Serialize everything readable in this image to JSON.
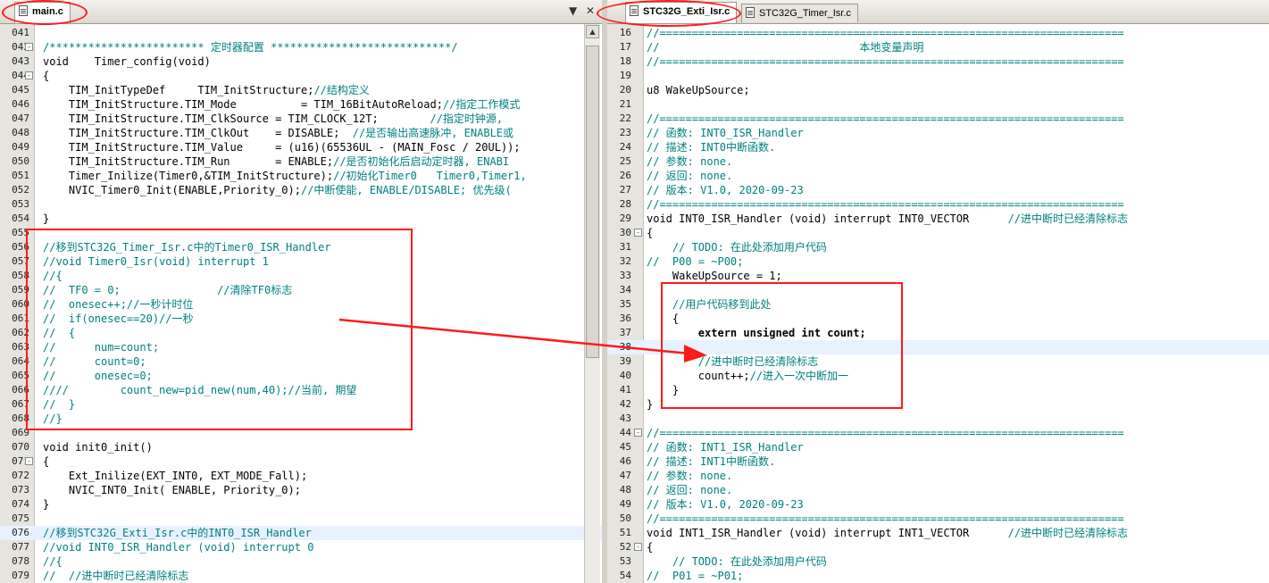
{
  "colors": {
    "comment": "#008080",
    "annotation": "#ff1a1a",
    "current_line": "#e8f2fe",
    "gutter": "#e6e4de"
  },
  "left_editor": {
    "tabs": [
      {
        "label": "main.c",
        "icon": "file-icon",
        "active": true
      }
    ],
    "tab_controls": {
      "dropdown": "▼",
      "close": "✕"
    },
    "lines": [
      {
        "n": "041",
        "t": "",
        "fold": ""
      },
      {
        "n": "042",
        "t": "/************************ 定时器配置 ****************************/",
        "fold": "-",
        "style": "cm"
      },
      {
        "n": "043",
        "t": "void    Timer_config(void)",
        "fold": ""
      },
      {
        "n": "044",
        "t": "{",
        "fold": "-"
      },
      {
        "n": "045",
        "t": "    TIM_InitTypeDef     TIM_InitStructure;//结构定义",
        "fold": ""
      },
      {
        "n": "046",
        "t": "    TIM_InitStructure.TIM_Mode          = TIM_16BitAutoReload;//指定工作模式",
        "fold": ""
      },
      {
        "n": "047",
        "t": "    TIM_InitStructure.TIM_ClkSource = TIM_CLOCK_12T;        //指定时钟源,",
        "fold": ""
      },
      {
        "n": "048",
        "t": "    TIM_InitStructure.TIM_ClkOut    = DISABLE;  //是否输出高速脉冲, ENABLE或",
        "fold": ""
      },
      {
        "n": "049",
        "t": "    TIM_InitStructure.TIM_Value     = (u16)(65536UL - (MAIN_Fosc / 20UL));",
        "fold": ""
      },
      {
        "n": "050",
        "t": "    TIM_InitStructure.TIM_Run       = ENABLE;//是否初始化后启动定时器, ENABI",
        "fold": ""
      },
      {
        "n": "051",
        "t": "    Timer_Inilize(Timer0,&TIM_InitStructure);//初始化Timer0   Timer0,Timer1,",
        "fold": ""
      },
      {
        "n": "052",
        "t": "    NVIC_Timer0_Init(ENABLE,Priority_0);//中断使能, ENABLE/DISABLE; 优先级(",
        "fold": ""
      },
      {
        "n": "053",
        "t": "",
        "fold": ""
      },
      {
        "n": "054",
        "t": "}",
        "fold": ""
      },
      {
        "n": "055",
        "t": "",
        "fold": ""
      },
      {
        "n": "056",
        "t": "//移到STC32G_Timer_Isr.c中的Timer0_ISR_Handler",
        "fold": "",
        "style": "cm"
      },
      {
        "n": "057",
        "t": "//void Timer0_Isr(void) interrupt 1",
        "fold": "",
        "style": "cm"
      },
      {
        "n": "058",
        "t": "//{",
        "fold": "",
        "style": "cm"
      },
      {
        "n": "059",
        "t": "//  TF0 = 0;               //清除TF0标志",
        "fold": "",
        "style": "cm"
      },
      {
        "n": "060",
        "t": "//  onesec++;//一秒计时位",
        "fold": "",
        "style": "cm"
      },
      {
        "n": "061",
        "t": "//  if(onesec==20)//一秒",
        "fold": "",
        "style": "cm"
      },
      {
        "n": "062",
        "t": "//  {",
        "fold": "",
        "style": "cm"
      },
      {
        "n": "063",
        "t": "//      num=count;",
        "fold": "",
        "style": "cm"
      },
      {
        "n": "064",
        "t": "//      count=0;",
        "fold": "",
        "style": "cm"
      },
      {
        "n": "065",
        "t": "//      onesec=0;",
        "fold": "",
        "style": "cm"
      },
      {
        "n": "066",
        "t": "////        count_new=pid_new(num,40);//当前, 期望",
        "fold": "",
        "style": "cm"
      },
      {
        "n": "067",
        "t": "//  }",
        "fold": "",
        "style": "cm"
      },
      {
        "n": "068",
        "t": "//}",
        "fold": "",
        "style": "cm"
      },
      {
        "n": "069",
        "t": "",
        "fold": ""
      },
      {
        "n": "070",
        "t": "void init0_init()",
        "fold": ""
      },
      {
        "n": "071",
        "t": "{",
        "fold": "-"
      },
      {
        "n": "072",
        "t": "    Ext_Inilize(EXT_INT0, EXT_MODE_Fall);",
        "fold": ""
      },
      {
        "n": "073",
        "t": "    NVIC_INT0_Init( ENABLE, Priority_0);",
        "fold": ""
      },
      {
        "n": "074",
        "t": "}",
        "fold": ""
      },
      {
        "n": "075",
        "t": "",
        "fold": ""
      },
      {
        "n": "076",
        "t": "//移到STC32G_Exti_Isr.c中的INT0_ISR_Handler",
        "fold": "",
        "style": "cm",
        "current": true
      },
      {
        "n": "077",
        "t": "//void INT0_ISR_Handler (void) interrupt 0",
        "fold": "",
        "style": "cm"
      },
      {
        "n": "078",
        "t": "//{",
        "fold": "",
        "style": "cm"
      },
      {
        "n": "079",
        "t": "//  //进中断时已经清除标志",
        "fold": "",
        "style": "cm"
      }
    ]
  },
  "right_editor": {
    "tabs": [
      {
        "label": "STC32G_Exti_Isr.c",
        "icon": "file-icon",
        "active": true
      },
      {
        "label": "STC32G_Timer_Isr.c",
        "icon": "file-icon",
        "active": false
      }
    ],
    "lines": [
      {
        "n": "16",
        "t": "//========================================================================",
        "fold": "",
        "style": "cm"
      },
      {
        "n": "17",
        "t": "//                               本地变量声明",
        "fold": "",
        "style": "cm"
      },
      {
        "n": "18",
        "t": "//========================================================================",
        "fold": "",
        "style": "cm"
      },
      {
        "n": "19",
        "t": "",
        "fold": ""
      },
      {
        "n": "20",
        "t": "u8 WakeUpSource;",
        "fold": ""
      },
      {
        "n": "21",
        "t": "",
        "fold": ""
      },
      {
        "n": "22",
        "t": "//========================================================================",
        "fold": "",
        "style": "cm"
      },
      {
        "n": "23",
        "t": "// 函数: INT0_ISR_Handler",
        "fold": "",
        "style": "cm"
      },
      {
        "n": "24",
        "t": "// 描述: INT0中断函数.",
        "fold": "",
        "style": "cm"
      },
      {
        "n": "25",
        "t": "// 参数: none.",
        "fold": "",
        "style": "cm"
      },
      {
        "n": "26",
        "t": "// 返回: none.",
        "fold": "",
        "style": "cm"
      },
      {
        "n": "27",
        "t": "// 版本: V1.0, 2020-09-23",
        "fold": "",
        "style": "cm"
      },
      {
        "n": "28",
        "t": "//========================================================================",
        "fold": "",
        "style": "cm"
      },
      {
        "n": "29",
        "t": "void INT0_ISR_Handler (void) interrupt INT0_VECTOR      //进中断时已经清除标志",
        "fold": "",
        "mixed": true
      },
      {
        "n": "30",
        "t": "{",
        "fold": "-"
      },
      {
        "n": "31",
        "t": "    // TODO: 在此处添加用户代码",
        "fold": "",
        "style": "cm"
      },
      {
        "n": "32",
        "t": "//  P00 = ~P00;",
        "fold": "",
        "style": "cm"
      },
      {
        "n": "33",
        "t": "    WakeUpSource = 1;",
        "fold": ""
      },
      {
        "n": "34",
        "t": "",
        "fold": ""
      },
      {
        "n": "35",
        "t": "    //用户代码移到此处",
        "fold": "",
        "style": "cm"
      },
      {
        "n": "36",
        "t": "    {",
        "fold": ""
      },
      {
        "n": "37",
        "t": "        extern unsigned int count;",
        "fold": "",
        "style": "bold"
      },
      {
        "n": "38",
        "t": "        ",
        "fold": "",
        "current": true
      },
      {
        "n": "39",
        "t": "        //进中断时已经清除标志",
        "fold": "",
        "style": "cm"
      },
      {
        "n": "40",
        "t": "        count++;//进入一次中断加一",
        "fold": "",
        "mixed2": true
      },
      {
        "n": "41",
        "t": "    }",
        "fold": ""
      },
      {
        "n": "42",
        "t": "}",
        "fold": ""
      },
      {
        "n": "43",
        "t": "",
        "fold": ""
      },
      {
        "n": "44",
        "t": "//========================================================================",
        "fold": "-",
        "style": "cm"
      },
      {
        "n": "45",
        "t": "// 函数: INT1_ISR_Handler",
        "fold": "",
        "style": "cm"
      },
      {
        "n": "46",
        "t": "// 描述: INT1中断函数.",
        "fold": "",
        "style": "cm"
      },
      {
        "n": "47",
        "t": "// 参数: none.",
        "fold": "",
        "style": "cm"
      },
      {
        "n": "48",
        "t": "// 返回: none.",
        "fold": "",
        "style": "cm"
      },
      {
        "n": "49",
        "t": "// 版本: V1.0, 2020-09-23",
        "fold": "",
        "style": "cm"
      },
      {
        "n": "50",
        "t": "//========================================================================",
        "fold": "",
        "style": "cm"
      },
      {
        "n": "51",
        "t": "void INT1_ISR_Handler (void) interrupt INT1_VECTOR      //进中断时已经清除标志",
        "fold": "",
        "mixed": true
      },
      {
        "n": "52",
        "t": "{",
        "fold": "-"
      },
      {
        "n": "53",
        "t": "    // TODO: 在此处添加用户代码",
        "fold": "",
        "style": "cm"
      },
      {
        "n": "54",
        "t": "//  P01 = ~P01;",
        "fold": "",
        "style": "cm"
      }
    ]
  }
}
